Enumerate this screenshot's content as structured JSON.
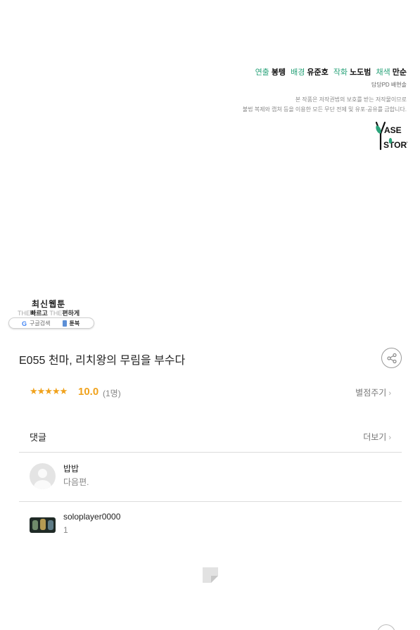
{
  "credits": {
    "items": [
      {
        "role": "연출",
        "name": "봉텡"
      },
      {
        "role": "배경",
        "name": "유준호"
      },
      {
        "role": "작화",
        "name": "노도범"
      },
      {
        "role": "채색",
        "name": "만순"
      }
    ],
    "pd": "담당PD 배현솔",
    "notice_line1": "본 작품은 저작권법의 보호를 받는 저작물이므로",
    "notice_line2": "불법 복제와 캡쳐 등을 이용한 모든 무단 전제 및 유포·공유를 금합니다."
  },
  "logo": {
    "icon": "base-story-logo",
    "text": "BASE STORY"
  },
  "ad_badge": {
    "title": "최신웹툰",
    "sub_the1": "THE",
    "sub_fast": "빠르고",
    "sub_the2": "THE",
    "sub_easy": "편하게",
    "google_icon": "G",
    "google_label": "구글검색",
    "toon_label": "툰북"
  },
  "episode": {
    "title": "E055 천마, 리치왕의 무림을 부수다",
    "share_icon": "share-icon"
  },
  "rating": {
    "stars": "★★★★★",
    "score": "10.0",
    "count": "(1명)",
    "rate_label": "별점주기",
    "chevron": "›",
    "colors": {
      "star": "#f0a21c"
    }
  },
  "comments": {
    "title": "댓글",
    "more_label": "더보기",
    "chevron": "›",
    "items": [
      {
        "author": "밥밥",
        "text": "다음편."
      },
      {
        "author": "soloplayer0000",
        "text": "1"
      }
    ]
  },
  "colors": {
    "accent": "#2aa37a",
    "rating": "#f0a21c"
  }
}
